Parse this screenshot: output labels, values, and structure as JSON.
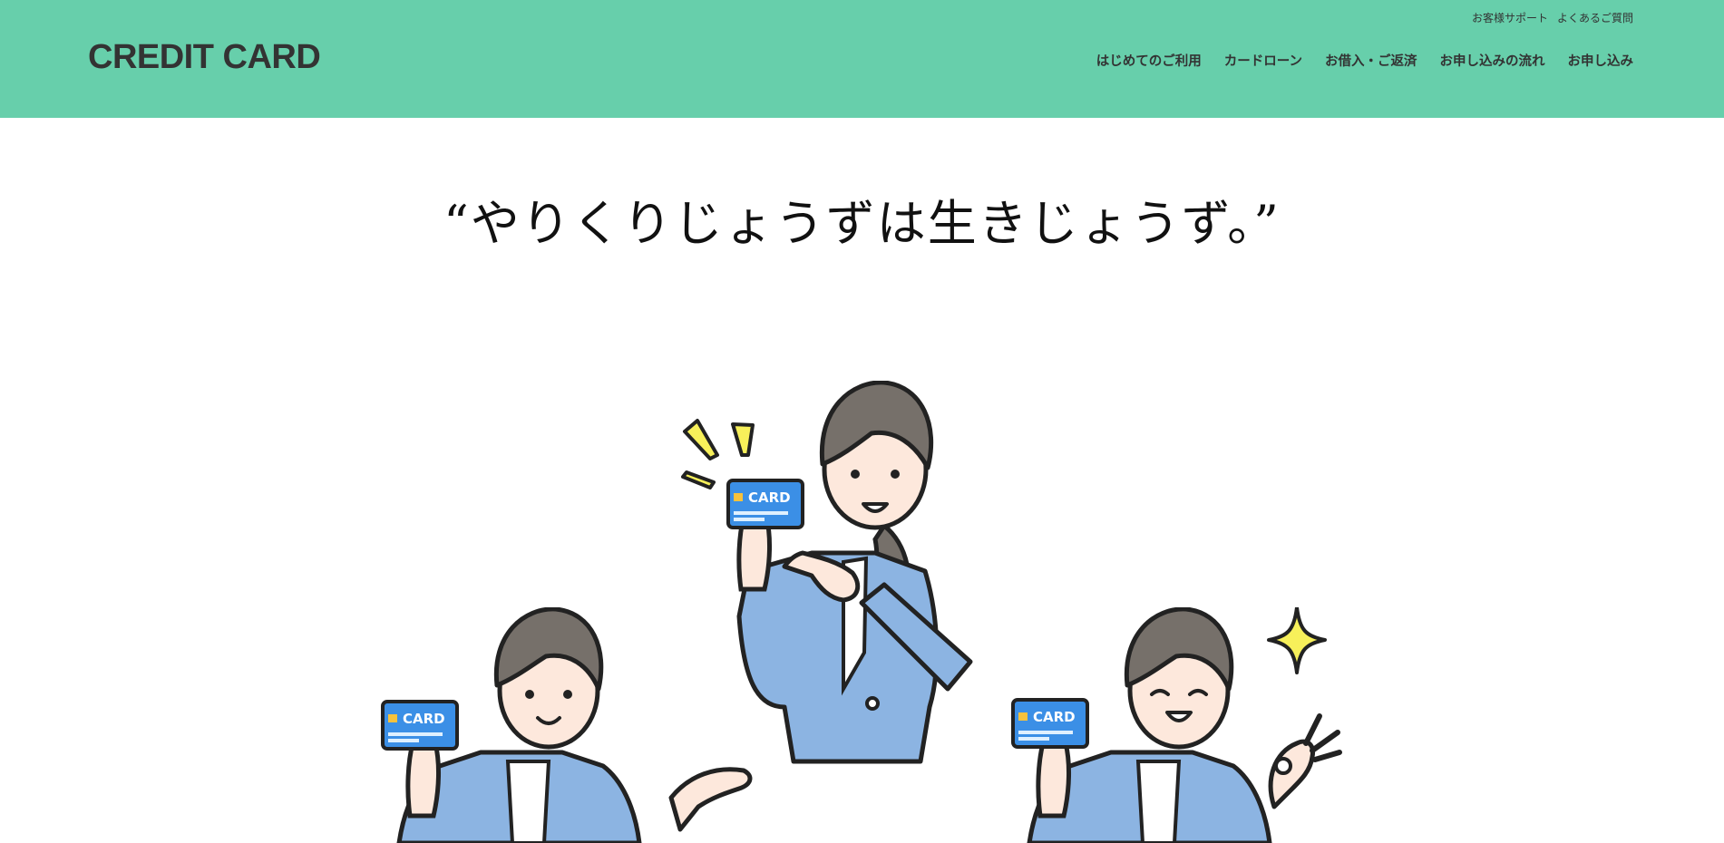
{
  "header": {
    "logo": "CREDIT CARD",
    "utility_links": [
      "お客様サポート",
      "よくあるご質問"
    ],
    "nav_items": [
      "はじめてのご利用",
      "カードローン",
      "お借入・ご返済",
      "お申し込みの流れ",
      "お申し込み"
    ]
  },
  "hero": {
    "title": "“やりくりじょうずは生きじょうず。”"
  },
  "illustration": {
    "card_text": "CARD",
    "colors": {
      "header_bg": "#67cfab",
      "jacket": "#8cb4e2",
      "card": "#3b8fe6",
      "accent": "#f7f05a",
      "hair": "#76706a",
      "skin": "#fde8dc"
    }
  }
}
